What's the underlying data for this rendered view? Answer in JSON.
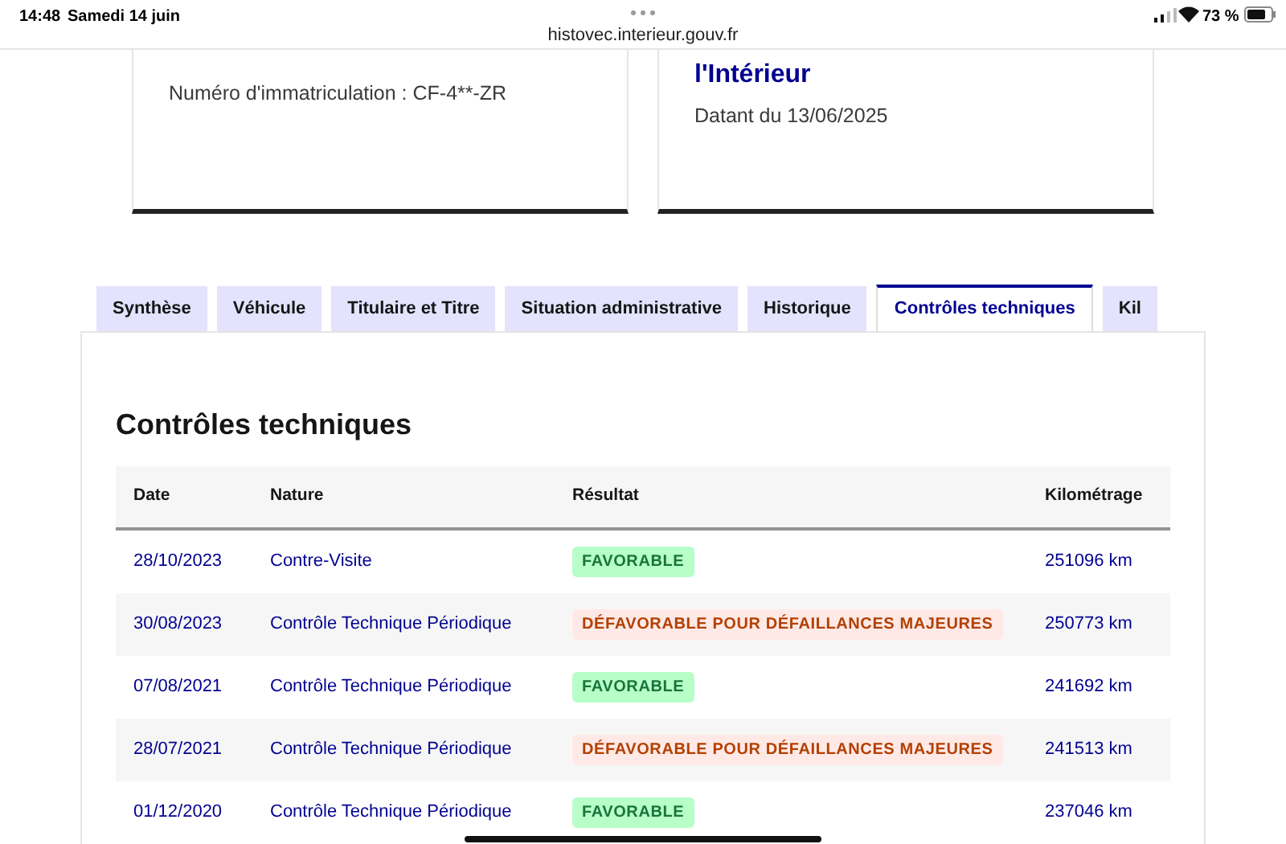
{
  "status_bar": {
    "time": "14:48",
    "date": "Samedi 14 juin",
    "url": "histovec.interieur.gouv.fr",
    "battery": "73 %"
  },
  "cards": [
    {
      "text": "Numéro d'immatriculation : CF-4**-ZR"
    },
    {
      "title": "l'Intérieur",
      "text": "Datant du 13/06/2025"
    }
  ],
  "tabs": [
    {
      "label": "Synthèse",
      "selected": false
    },
    {
      "label": "Véhicule",
      "selected": false
    },
    {
      "label": "Titulaire et Titre",
      "selected": false
    },
    {
      "label": "Situation administrative",
      "selected": false
    },
    {
      "label": "Historique",
      "selected": false
    },
    {
      "label": "Contrôles techniques",
      "selected": true
    },
    {
      "label": "Kil",
      "selected": false
    }
  ],
  "section_title": "Contrôles techniques",
  "table": {
    "columns": [
      "Date",
      "Nature",
      "Résultat",
      "Kilométrage"
    ],
    "rows": [
      {
        "date": "28/10/2023",
        "nature": "Contre-Visite",
        "result": {
          "kind": "favorable",
          "label": "FAVORABLE"
        },
        "km": "251096 km"
      },
      {
        "date": "30/08/2023",
        "nature": "Contrôle Technique Périodique",
        "result": {
          "kind": "defavorable",
          "label": "DÉFAVORABLE POUR DÉFAILLANCES MAJEURES"
        },
        "km": "250773 km"
      },
      {
        "date": "07/08/2021",
        "nature": "Contrôle Technique Périodique",
        "result": {
          "kind": "favorable",
          "label": "FAVORABLE"
        },
        "km": "241692 km"
      },
      {
        "date": "28/07/2021",
        "nature": "Contrôle Technique Périodique",
        "result": {
          "kind": "defavorable",
          "label": "DÉFAVORABLE POUR DÉFAILLANCES MAJEURES"
        },
        "km": "241513 km"
      },
      {
        "date": "01/12/2020",
        "nature": "Contrôle Technique Périodique",
        "result": {
          "kind": "favorable",
          "label": "FAVORABLE"
        },
        "km": "237046 km"
      }
    ]
  }
}
